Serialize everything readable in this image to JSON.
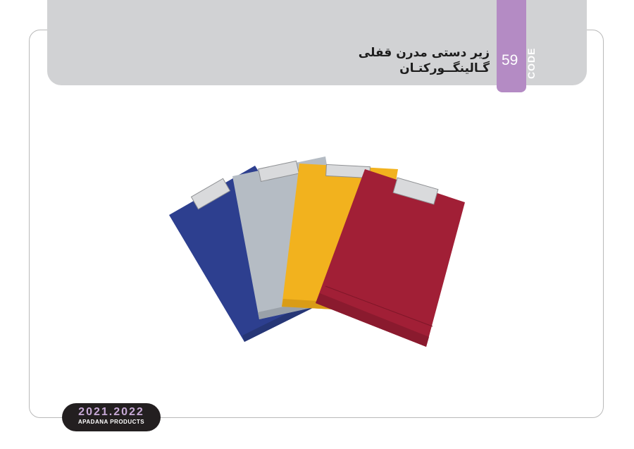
{
  "header": {
    "title_line1": "زیر دستی مدرن قفلی",
    "title_line2": "گـالینگــورکتـان",
    "code_number": "59",
    "code_label": "CODE"
  },
  "product": {
    "image_name": "clipboards-product-photo",
    "colors": [
      "#2d3f8f",
      "#b5bcc4",
      "#f2b21e",
      "#a11f36"
    ]
  },
  "footer": {
    "years": "2021.2022",
    "brand": "APADANA PRODUCTS"
  }
}
